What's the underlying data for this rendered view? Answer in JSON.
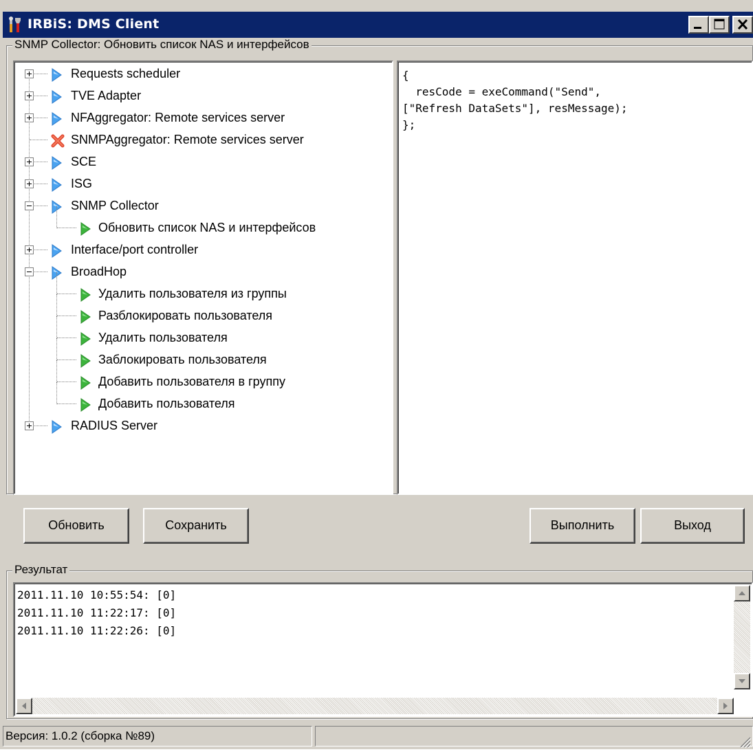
{
  "window": {
    "title": "IRBiS: DMS Client",
    "icon": "tools-icon",
    "controls": [
      "minimize",
      "maximize",
      "close"
    ]
  },
  "collector_group": {
    "legend": "SNMP Collector: Обновить список NAS и интерфейсов"
  },
  "tree": {
    "items": [
      {
        "label": "Requests scheduler",
        "level": 0,
        "expander": "plus",
        "icon": "blue-arrow-icon"
      },
      {
        "label": "TVE Adapter",
        "level": 0,
        "expander": "plus",
        "icon": "blue-arrow-icon"
      },
      {
        "label": "NFAggregator: Remote services server",
        "level": 0,
        "expander": "plus",
        "icon": "blue-arrow-icon"
      },
      {
        "label": "SNMPAggregator: Remote services server",
        "level": 0,
        "expander": "none",
        "icon": "red-x-icon"
      },
      {
        "label": "SCE",
        "level": 0,
        "expander": "plus",
        "icon": "blue-arrow-icon"
      },
      {
        "label": "ISG",
        "level": 0,
        "expander": "plus",
        "icon": "blue-arrow-icon"
      },
      {
        "label": "SNMP Collector",
        "level": 0,
        "expander": "minus",
        "icon": "blue-arrow-icon"
      },
      {
        "label": "Обновить список NAS и интерфейсов",
        "level": 1,
        "expander": "none",
        "icon": "green-arrow-icon"
      },
      {
        "label": "Interface/port controller",
        "level": 0,
        "expander": "plus",
        "icon": "blue-arrow-icon"
      },
      {
        "label": "BroadHop",
        "level": 0,
        "expander": "minus",
        "icon": "blue-arrow-icon"
      },
      {
        "label": "Удалить пользователя из группы",
        "level": 1,
        "expander": "none",
        "icon": "green-arrow-icon"
      },
      {
        "label": "Разблокировать пользователя",
        "level": 1,
        "expander": "none",
        "icon": "green-arrow-icon"
      },
      {
        "label": "Удалить пользователя",
        "level": 1,
        "expander": "none",
        "icon": "green-arrow-icon"
      },
      {
        "label": "Заблокировать пользователя",
        "level": 1,
        "expander": "none",
        "icon": "green-arrow-icon"
      },
      {
        "label": "Добавить пользователя в группу",
        "level": 1,
        "expander": "none",
        "icon": "green-arrow-icon"
      },
      {
        "label": "Добавить пользователя",
        "level": 1,
        "expander": "none",
        "icon": "green-arrow-icon"
      },
      {
        "label": "RADIUS Server",
        "level": 0,
        "expander": "plus",
        "icon": "blue-arrow-icon"
      }
    ]
  },
  "script_editor": {
    "text": "{\n  resCode = exeCommand(\"Send\",\n[\"Refresh DataSets\"], resMessage);\n};"
  },
  "buttons": {
    "refresh": "Обновить",
    "save": "Сохранить",
    "execute": "Выполнить",
    "exit": "Выход"
  },
  "result_group": {
    "legend": "Результат",
    "log": "2011.11.10 10:55:54: [0]\n2011.11.10 11:22:17: [0]\n2011.11.10 11:22:26: [0]"
  },
  "status_bar": {
    "version": "Версия: 1.0.2 (сборка №89)",
    "second_pane": ""
  },
  "colors": {
    "titlebar": "#0a246a",
    "face": "#d4d0c8",
    "blue_arrow": "#4aa3f0",
    "green_arrow": "#3cb43c",
    "red_x": "#e0442c"
  }
}
